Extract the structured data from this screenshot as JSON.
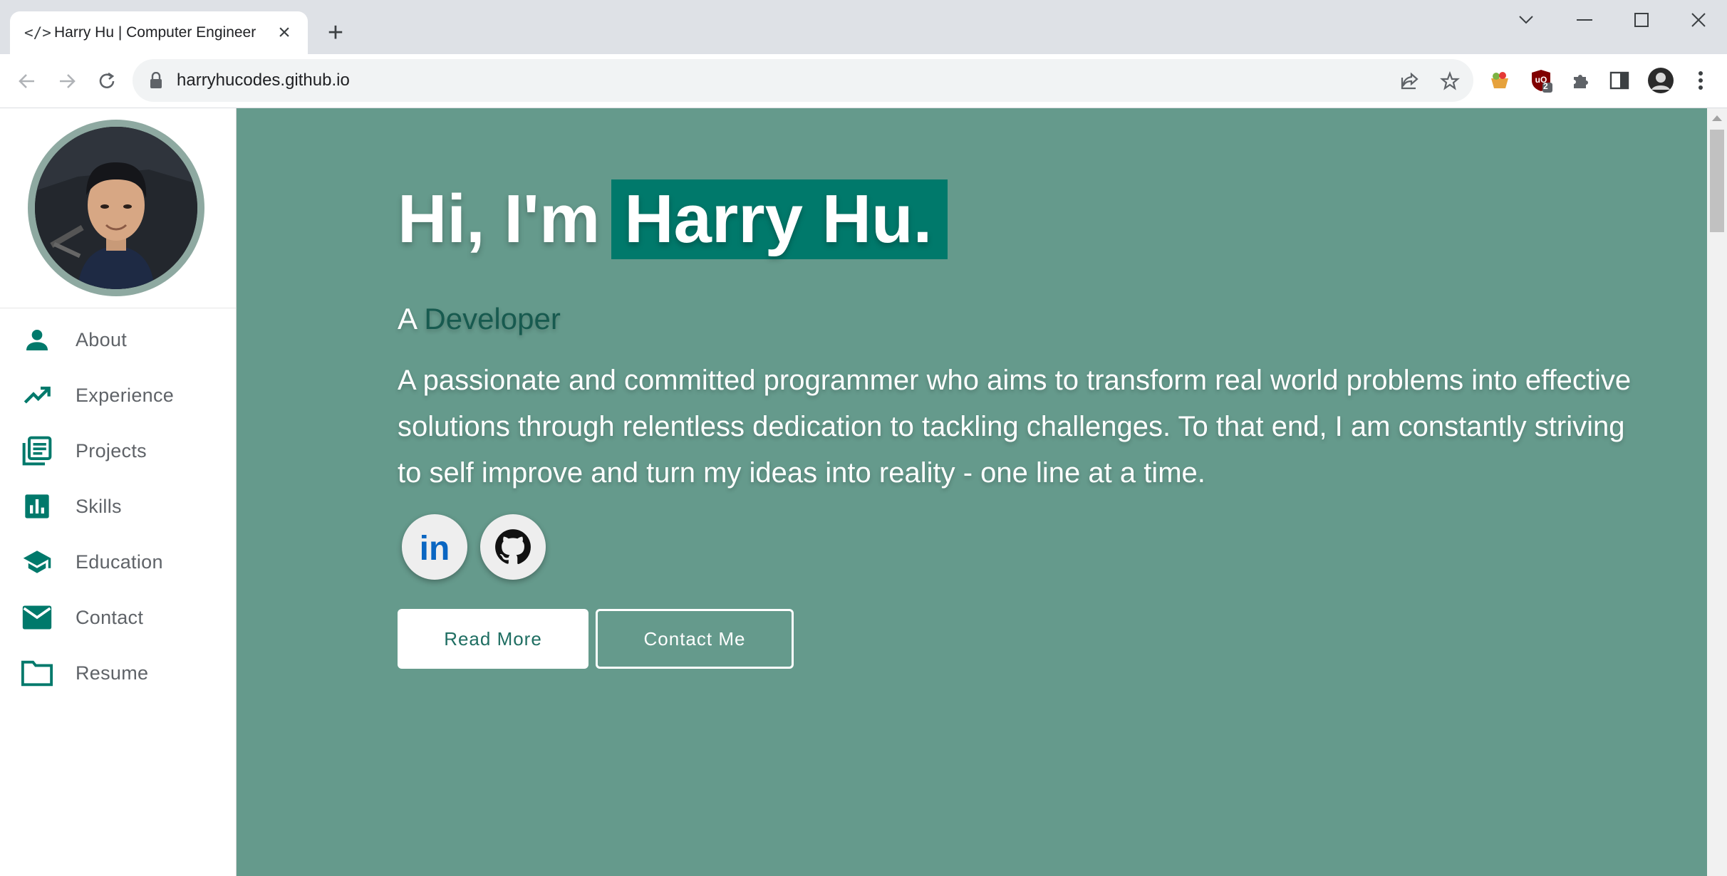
{
  "browser": {
    "tab_title": "Harry Hu | Computer Engineer",
    "tab_favicon": "</>",
    "new_tab": "+",
    "url": "harryhucodes.github.io",
    "extension_badge": "2"
  },
  "profile": {
    "photo_alt": "profile-photo"
  },
  "sidebar": {
    "items": [
      {
        "label": "About",
        "icon": "person-icon"
      },
      {
        "label": "Experience",
        "icon": "trending-up-icon"
      },
      {
        "label": "Projects",
        "icon": "library-books-icon"
      },
      {
        "label": "Skills",
        "icon": "bar-chart-icon"
      },
      {
        "label": "Education",
        "icon": "school-icon"
      },
      {
        "label": "Contact",
        "icon": "mail-icon"
      },
      {
        "label": "Resume",
        "icon": "folder-icon"
      }
    ]
  },
  "hero": {
    "greeting": "Hi, I'm",
    "name": "Harry Hu.",
    "subtitle_prefix": "A",
    "subtitle_role": "Developer",
    "description": "A passionate and committed programmer who aims to transform real world problems into effective solutions through relentless dedication to tackling challenges. To that end, I am constantly striving to self improve and turn my ideas into reality - one line at a time.",
    "read_more": "Read More",
    "contact_me": "Contact Me"
  },
  "colors": {
    "accent": "#00796b",
    "hero_bg": "#659a8c",
    "nav_icon": "#00796b"
  }
}
